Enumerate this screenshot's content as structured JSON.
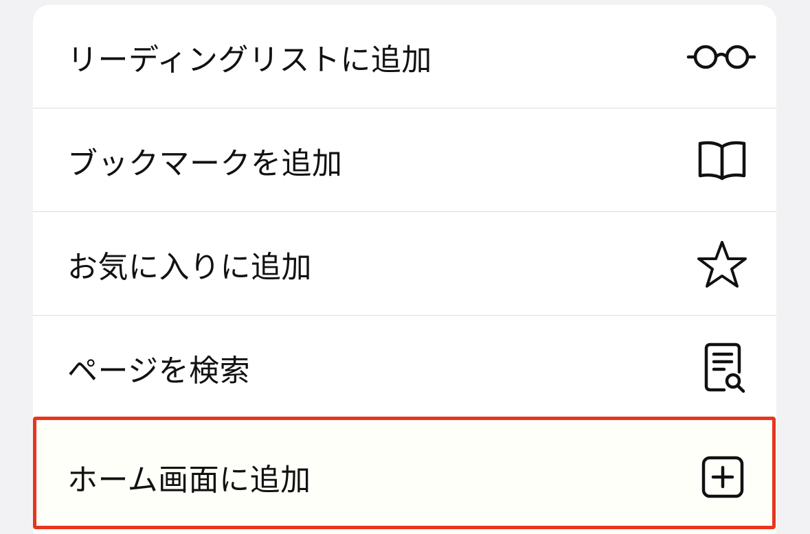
{
  "menu": {
    "items": [
      {
        "label": "リーディングリストに追加",
        "icon": "glasses-icon"
      },
      {
        "label": "ブックマークを追加",
        "icon": "book-icon"
      },
      {
        "label": "お気に入りに追加",
        "icon": "star-icon"
      },
      {
        "label": "ページを検索",
        "icon": "document-search-icon"
      },
      {
        "label": "ホーム画面に追加",
        "icon": "plus-square-icon",
        "highlighted": true
      }
    ]
  },
  "colors": {
    "background": "#f2f2f4",
    "menu_background": "#ffffff",
    "highlight_border": "#e8351e",
    "text": "#111111",
    "separator": "#dcdcdf"
  }
}
